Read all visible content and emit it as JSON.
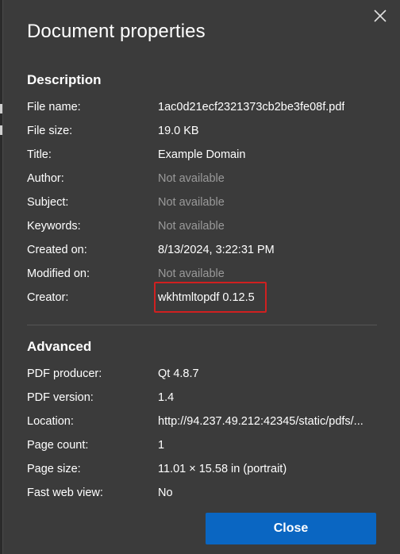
{
  "dialog": {
    "title": "Document properties",
    "close_icon": "close-icon"
  },
  "description": {
    "heading": "Description",
    "rows": [
      {
        "label": "File name:",
        "value": "1ac0d21ecf2321373cb2be3fe08f.pdf",
        "muted": false
      },
      {
        "label": "File size:",
        "value": "19.0 KB",
        "muted": false
      },
      {
        "label": "Title:",
        "value": "Example Domain",
        "muted": false
      },
      {
        "label": "Author:",
        "value": "Not available",
        "muted": true
      },
      {
        "label": "Subject:",
        "value": "Not available",
        "muted": true
      },
      {
        "label": "Keywords:",
        "value": "Not available",
        "muted": true
      },
      {
        "label": "Created on:",
        "value": "8/13/2024, 3:22:31 PM",
        "muted": false
      },
      {
        "label": "Modified on:",
        "value": "Not available",
        "muted": true
      },
      {
        "label": "Creator:",
        "value": "wkhtmltopdf 0.12.5",
        "muted": false
      }
    ]
  },
  "advanced": {
    "heading": "Advanced",
    "rows": [
      {
        "label": "PDF producer:",
        "value": "Qt 4.8.7"
      },
      {
        "label": "PDF version:",
        "value": "1.4"
      },
      {
        "label": "Location:",
        "value": "http://94.237.49.212:42345/static/pdfs/..."
      },
      {
        "label": "Page count:",
        "value": "1"
      },
      {
        "label": "Page size:",
        "value": "11.01 × 15.58 in (portrait)"
      },
      {
        "label": "Fast web view:",
        "value": "No"
      }
    ]
  },
  "footer": {
    "close_label": "Close"
  },
  "colors": {
    "dialog_bg": "#3b3b3b",
    "muted_text": "#9a9a9a",
    "button_bg": "#0a66c2",
    "highlight_border": "#d02020"
  }
}
